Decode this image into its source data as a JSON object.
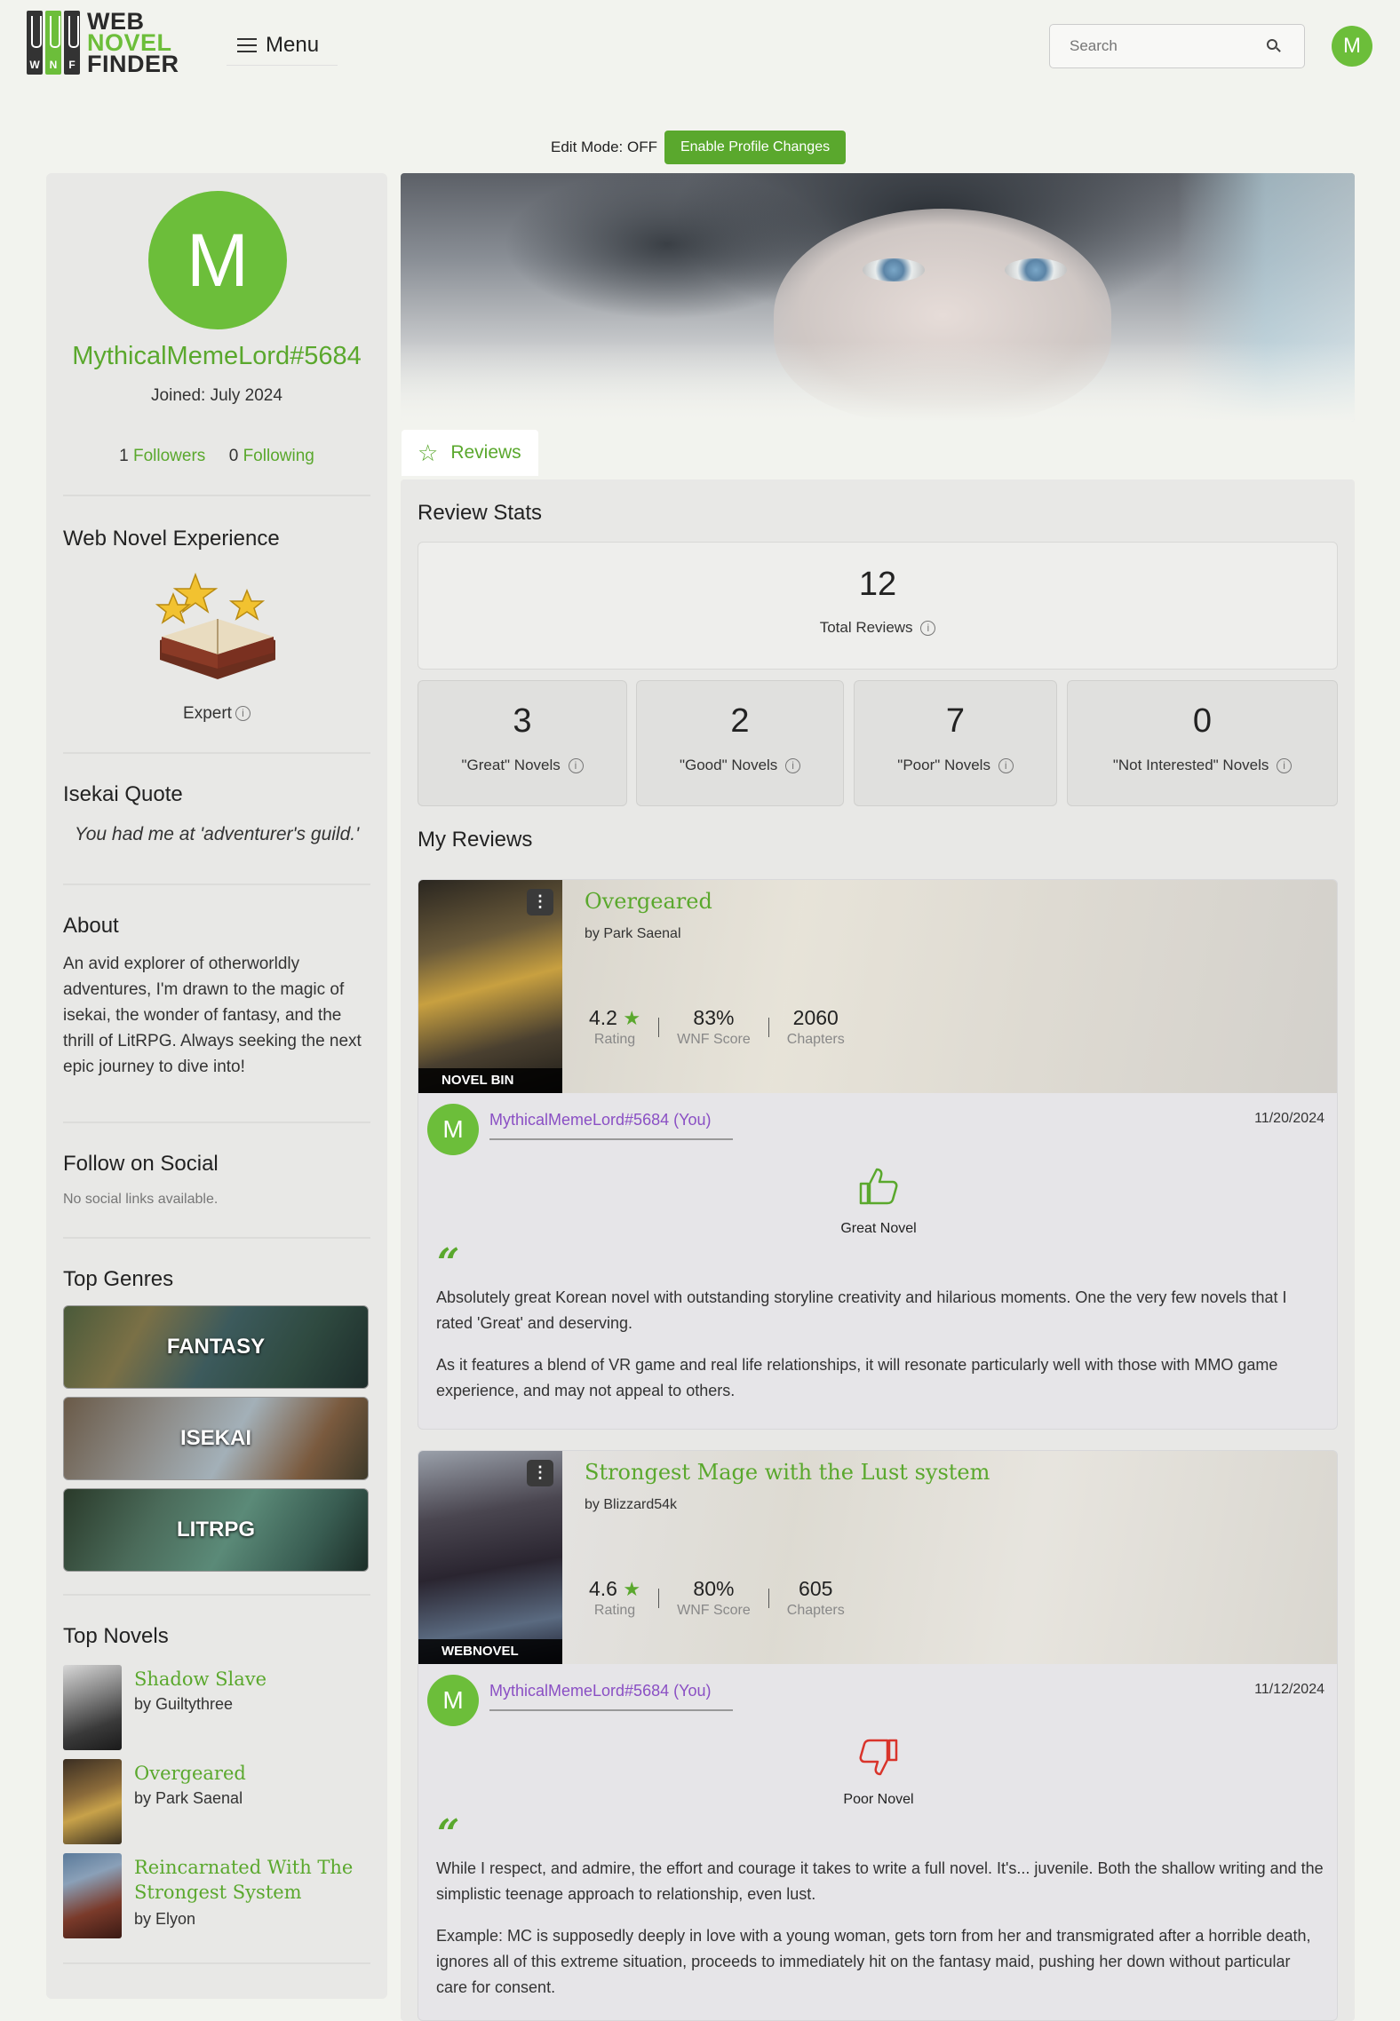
{
  "header": {
    "logo": {
      "line1": "WEB",
      "line2": "NOVEL",
      "line3": "FINDER",
      "letters": [
        "W",
        "N",
        "F"
      ]
    },
    "menu_label": "Menu",
    "search_placeholder": "Search",
    "avatar_letter": "M"
  },
  "edit_mode": {
    "status": "Edit Mode: OFF",
    "button": "Enable Profile Changes"
  },
  "profile": {
    "avatar_letter": "M",
    "username": "MythicalMemeLord#5684",
    "joined": "Joined: July 2024",
    "followers_count": "1",
    "followers_label": "Followers",
    "following_count": "0",
    "following_label": "Following"
  },
  "sidebar": {
    "experience_heading": "Web Novel Experience",
    "experience_level": "Expert",
    "quote_heading": "Isekai Quote",
    "quote": "You had me at 'adventurer's guild.'",
    "about_heading": "About",
    "about_text": "An avid explorer of otherworldly adventures, I'm drawn to the magic of isekai, the wonder of fantasy, and the thrill of LitRPG. Always seeking the next epic journey to dive into!",
    "social_heading": "Follow on Social",
    "social_empty": "No social links available.",
    "genres_heading": "Top Genres",
    "genres": [
      "FANTASY",
      "ISEKAI",
      "LITRPG"
    ],
    "novels_heading": "Top Novels",
    "novels": [
      {
        "title": "Shadow Slave",
        "author": "by Guiltythree"
      },
      {
        "title": "Overgeared",
        "author": "by Park Saenal"
      },
      {
        "title": "Reincarnated With The Strongest System",
        "author": "by Elyon"
      }
    ]
  },
  "tabs": [
    {
      "label": "Reviews",
      "icon": "star-outline-icon"
    }
  ],
  "stats": {
    "heading": "Review Stats",
    "total": {
      "value": "12",
      "label": "Total Reviews"
    },
    "breakdown": [
      {
        "value": "3",
        "label": "\"Great\" Novels"
      },
      {
        "value": "2",
        "label": "\"Good\" Novels"
      },
      {
        "value": "7",
        "label": "\"Poor\" Novels"
      },
      {
        "value": "0",
        "label": "\"Not Interested\" Novels"
      }
    ]
  },
  "reviews_heading": "My Reviews",
  "reviews": [
    {
      "title": "Overgeared",
      "author": "by Park Saenal",
      "source_badge": "NOVEL BIN",
      "rating": "4.2",
      "rating_label": "Rating",
      "wnf_score": "83%",
      "wnf_label": "WNF Score",
      "chapters": "2060",
      "chapters_label": "Chapters",
      "user": "MythicalMemeLord#5684 (You)",
      "user_avatar": "M",
      "date": "11/20/2024",
      "verdict": "Great Novel",
      "verdict_icon": "thumbs-up-icon",
      "verdict_color": "#5aa82d",
      "body": [
        "Absolutely great Korean novel with outstanding storyline creativity and hilarious moments. One the very few novels that I rated 'Great' and deserving.",
        "As it features a blend of VR game and real life relationships, it will resonate particularly well with those with MMO game experience, and may not appeal to others."
      ]
    },
    {
      "title": "Strongest Mage with the Lust system",
      "author": "by Blizzard54k",
      "source_badge": "WEBNOVEL",
      "rating": "4.6",
      "rating_label": "Rating",
      "wnf_score": "80%",
      "wnf_label": "WNF Score",
      "chapters": "605",
      "chapters_label": "Chapters",
      "user": "MythicalMemeLord#5684 (You)",
      "user_avatar": "M",
      "date": "11/12/2024",
      "verdict": "Poor Novel",
      "verdict_icon": "thumbs-down-icon",
      "verdict_color": "#d9342b",
      "body": [
        "While I respect, and admire, the effort and courage it takes to write a full novel. It's... juvenile. Both the shallow writing and the simplistic teenage approach to relationship, even lust.",
        "Example: MC is supposedly deeply in love with a young woman, gets torn from her and transmigrated after a horrible death, ignores all of this extreme situation, proceeds to immediately hit on the fantasy maid, pushing her down without particular care for consent."
      ]
    }
  ],
  "colors": {
    "accent": "#5aa82d",
    "avatar": "#6cbe3a",
    "username_link": "#8a4fc4"
  }
}
